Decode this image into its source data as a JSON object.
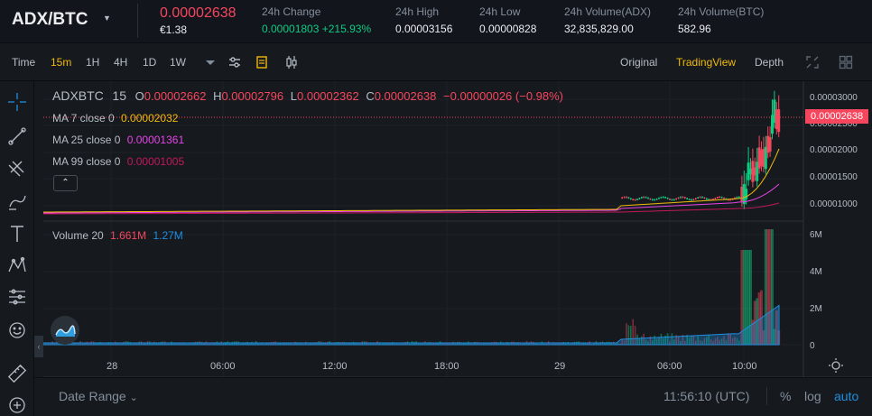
{
  "header": {
    "pair": "ADX/BTC",
    "price": "0.00002638",
    "price_fiat": "€1.38",
    "stats": [
      {
        "label": "24h Change",
        "value": "0.00001803 +215.93%"
      },
      {
        "label": "24h High",
        "value": "0.00003156"
      },
      {
        "label": "24h Low",
        "value": "0.00000828"
      },
      {
        "label": "24h Volume(ADX)",
        "value": "32,835,829.00"
      },
      {
        "label": "24h Volume(BTC)",
        "value": "582.96"
      }
    ]
  },
  "toolbar": {
    "time_label": "Time",
    "intervals": [
      "15m",
      "1H",
      "4H",
      "1D",
      "1W"
    ],
    "active_interval": "15m",
    "views": [
      "Original",
      "TradingView",
      "Depth"
    ],
    "active_view": "TradingView"
  },
  "legend": {
    "symbol": "ADXBTC",
    "interval": "15",
    "o_label": "O",
    "o_value": "0.00002662",
    "h_label": "H",
    "h_value": "0.00002796",
    "l_label": "L",
    "l_value": "0.00002362",
    "c_label": "C",
    "c_value": "0.00002638",
    "change": "−0.00000026 (−0.98%)",
    "ma": [
      {
        "label": "MA 7 close 0",
        "value": "0.00002032",
        "color": "#f0b90b"
      },
      {
        "label": "MA 25 close 0",
        "value": "0.00001361",
        "color": "#e843e8"
      },
      {
        "label": "MA 99 close 0",
        "value": "0.00001005",
        "color": "#c2185b"
      }
    ],
    "volume_label": "Volume 20",
    "volume_value": "1.661M",
    "volume_ma_value": "1.27M",
    "collapse_glyph": "⌃"
  },
  "price_axis": {
    "ticks": [
      "0.00003000",
      "0.00002500",
      "0.00002000",
      "0.00001500",
      "0.00001000"
    ],
    "current_price": "0.00002638"
  },
  "volume_axis": {
    "ticks": [
      "6M",
      "4M",
      "2M",
      "0"
    ]
  },
  "time_axis": {
    "ticks": [
      "28",
      "06:00",
      "12:00",
      "18:00",
      "29",
      "06:00",
      "10:00"
    ]
  },
  "bottom": {
    "date_range": "Date Range",
    "date_range_caret": "⌄",
    "clock": "11:56:10 (UTC)",
    "percent": "%",
    "log": "log",
    "auto": "auto"
  },
  "colors": {
    "up": "#0ecb81",
    "down": "#f6465d",
    "accent": "#f0b90b",
    "blue": "#1e8ee0"
  },
  "icons": {
    "pair_caret": "▼",
    "side_collapse": "‹"
  }
}
